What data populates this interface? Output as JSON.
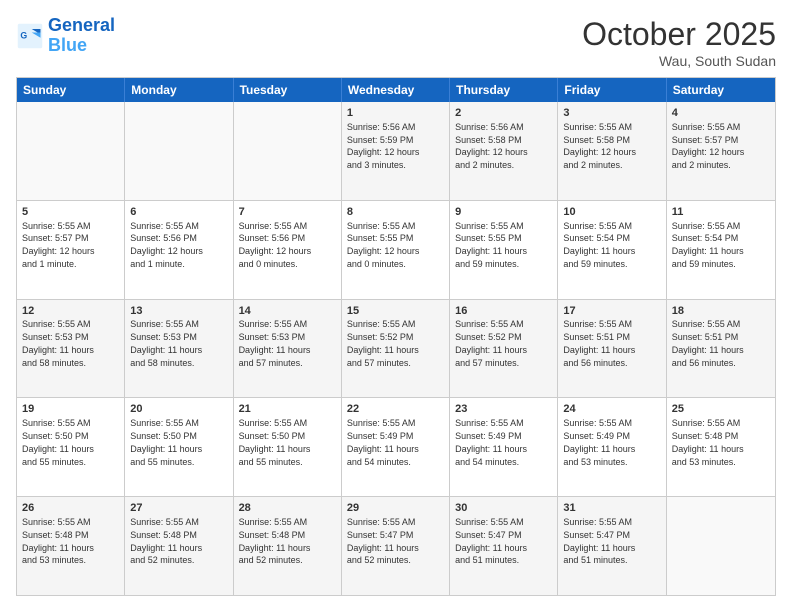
{
  "header": {
    "logo_general": "General",
    "logo_blue": "Blue",
    "month_title": "October 2025",
    "location": "Wau, South Sudan"
  },
  "weekdays": [
    "Sunday",
    "Monday",
    "Tuesday",
    "Wednesday",
    "Thursday",
    "Friday",
    "Saturday"
  ],
  "rows": [
    [
      {
        "day": "",
        "text": ""
      },
      {
        "day": "",
        "text": ""
      },
      {
        "day": "",
        "text": ""
      },
      {
        "day": "1",
        "text": "Sunrise: 5:56 AM\nSunset: 5:59 PM\nDaylight: 12 hours\nand 3 minutes."
      },
      {
        "day": "2",
        "text": "Sunrise: 5:56 AM\nSunset: 5:58 PM\nDaylight: 12 hours\nand 2 minutes."
      },
      {
        "day": "3",
        "text": "Sunrise: 5:55 AM\nSunset: 5:58 PM\nDaylight: 12 hours\nand 2 minutes."
      },
      {
        "day": "4",
        "text": "Sunrise: 5:55 AM\nSunset: 5:57 PM\nDaylight: 12 hours\nand 2 minutes."
      }
    ],
    [
      {
        "day": "5",
        "text": "Sunrise: 5:55 AM\nSunset: 5:57 PM\nDaylight: 12 hours\nand 1 minute."
      },
      {
        "day": "6",
        "text": "Sunrise: 5:55 AM\nSunset: 5:56 PM\nDaylight: 12 hours\nand 1 minute."
      },
      {
        "day": "7",
        "text": "Sunrise: 5:55 AM\nSunset: 5:56 PM\nDaylight: 12 hours\nand 0 minutes."
      },
      {
        "day": "8",
        "text": "Sunrise: 5:55 AM\nSunset: 5:55 PM\nDaylight: 12 hours\nand 0 minutes."
      },
      {
        "day": "9",
        "text": "Sunrise: 5:55 AM\nSunset: 5:55 PM\nDaylight: 11 hours\nand 59 minutes."
      },
      {
        "day": "10",
        "text": "Sunrise: 5:55 AM\nSunset: 5:54 PM\nDaylight: 11 hours\nand 59 minutes."
      },
      {
        "day": "11",
        "text": "Sunrise: 5:55 AM\nSunset: 5:54 PM\nDaylight: 11 hours\nand 59 minutes."
      }
    ],
    [
      {
        "day": "12",
        "text": "Sunrise: 5:55 AM\nSunset: 5:53 PM\nDaylight: 11 hours\nand 58 minutes."
      },
      {
        "day": "13",
        "text": "Sunrise: 5:55 AM\nSunset: 5:53 PM\nDaylight: 11 hours\nand 58 minutes."
      },
      {
        "day": "14",
        "text": "Sunrise: 5:55 AM\nSunset: 5:53 PM\nDaylight: 11 hours\nand 57 minutes."
      },
      {
        "day": "15",
        "text": "Sunrise: 5:55 AM\nSunset: 5:52 PM\nDaylight: 11 hours\nand 57 minutes."
      },
      {
        "day": "16",
        "text": "Sunrise: 5:55 AM\nSunset: 5:52 PM\nDaylight: 11 hours\nand 57 minutes."
      },
      {
        "day": "17",
        "text": "Sunrise: 5:55 AM\nSunset: 5:51 PM\nDaylight: 11 hours\nand 56 minutes."
      },
      {
        "day": "18",
        "text": "Sunrise: 5:55 AM\nSunset: 5:51 PM\nDaylight: 11 hours\nand 56 minutes."
      }
    ],
    [
      {
        "day": "19",
        "text": "Sunrise: 5:55 AM\nSunset: 5:50 PM\nDaylight: 11 hours\nand 55 minutes."
      },
      {
        "day": "20",
        "text": "Sunrise: 5:55 AM\nSunset: 5:50 PM\nDaylight: 11 hours\nand 55 minutes."
      },
      {
        "day": "21",
        "text": "Sunrise: 5:55 AM\nSunset: 5:50 PM\nDaylight: 11 hours\nand 55 minutes."
      },
      {
        "day": "22",
        "text": "Sunrise: 5:55 AM\nSunset: 5:49 PM\nDaylight: 11 hours\nand 54 minutes."
      },
      {
        "day": "23",
        "text": "Sunrise: 5:55 AM\nSunset: 5:49 PM\nDaylight: 11 hours\nand 54 minutes."
      },
      {
        "day": "24",
        "text": "Sunrise: 5:55 AM\nSunset: 5:49 PM\nDaylight: 11 hours\nand 53 minutes."
      },
      {
        "day": "25",
        "text": "Sunrise: 5:55 AM\nSunset: 5:48 PM\nDaylight: 11 hours\nand 53 minutes."
      }
    ],
    [
      {
        "day": "26",
        "text": "Sunrise: 5:55 AM\nSunset: 5:48 PM\nDaylight: 11 hours\nand 53 minutes."
      },
      {
        "day": "27",
        "text": "Sunrise: 5:55 AM\nSunset: 5:48 PM\nDaylight: 11 hours\nand 52 minutes."
      },
      {
        "day": "28",
        "text": "Sunrise: 5:55 AM\nSunset: 5:48 PM\nDaylight: 11 hours\nand 52 minutes."
      },
      {
        "day": "29",
        "text": "Sunrise: 5:55 AM\nSunset: 5:47 PM\nDaylight: 11 hours\nand 52 minutes."
      },
      {
        "day": "30",
        "text": "Sunrise: 5:55 AM\nSunset: 5:47 PM\nDaylight: 11 hours\nand 51 minutes."
      },
      {
        "day": "31",
        "text": "Sunrise: 5:55 AM\nSunset: 5:47 PM\nDaylight: 11 hours\nand 51 minutes."
      },
      {
        "day": "",
        "text": ""
      }
    ]
  ],
  "alt_rows": [
    0,
    2,
    4
  ]
}
